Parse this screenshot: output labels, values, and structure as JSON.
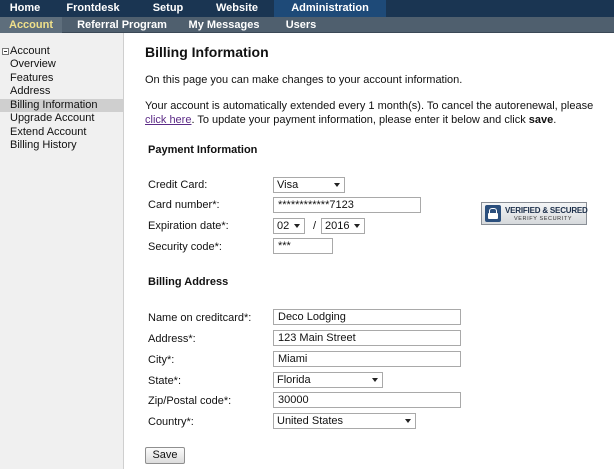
{
  "topnav": {
    "tabs": [
      {
        "label": "Home"
      },
      {
        "label": "Frontdesk"
      },
      {
        "label": "Setup"
      },
      {
        "label": "Website"
      },
      {
        "label": "Administration",
        "active": true
      }
    ]
  },
  "subnav": {
    "items": [
      {
        "label": "Account",
        "active": true
      },
      {
        "label": "Referral Program"
      },
      {
        "label": "My Messages"
      },
      {
        "label": "Users"
      }
    ]
  },
  "sidebar": {
    "heading": "Account",
    "items": [
      {
        "label": "Overview"
      },
      {
        "label": "Features"
      },
      {
        "label": "Address"
      },
      {
        "label": "Billing Information",
        "active": true
      },
      {
        "label": "Upgrade Account"
      },
      {
        "label": "Extend Account"
      },
      {
        "label": "Billing History"
      }
    ]
  },
  "main": {
    "title": "Billing Information",
    "intro": "On this page you can make changes to your account information.",
    "para_before_link": "Your account is automatically extended every 1 month(s). To cancel the autorenewal, please ",
    "link_text": "click here",
    "para_after_link": ". To update your payment information, please enter it below and click ",
    "save_word": "save",
    "para_end": "."
  },
  "payment": {
    "heading": "Payment Information",
    "credit_card_label": "Credit Card:",
    "credit_card_value": "Visa",
    "card_number_label": "Card number*:",
    "card_number_value": "************7123",
    "expiration_label": "Expiration date*:",
    "exp_month": "02",
    "exp_separator": "/",
    "exp_year": "2016",
    "security_label": "Security code*:",
    "security_value": "***"
  },
  "badge": {
    "line1": "VERIFIED & SECURED",
    "line2": "VERIFY SECURITY"
  },
  "billing": {
    "heading": "Billing Address",
    "name_label": "Name on creditcard*:",
    "name_value": "Deco Lodging",
    "address_label": "Address*:",
    "address_value": "123 Main Street",
    "city_label": "City*:",
    "city_value": "Miami",
    "state_label": "State*:",
    "state_value": "Florida",
    "zip_label": "Zip/Postal code*:",
    "zip_value": "30000",
    "country_label": "Country*:",
    "country_value": "United States"
  },
  "actions": {
    "save_label": "Save"
  },
  "colors": {
    "topnav_bg": "#1a3552",
    "subnav_bg": "#4f5f6e",
    "subnav_active_text": "#f0e08a",
    "link": "#5b2a86",
    "sidebar_bg": "#f0f0f0"
  }
}
